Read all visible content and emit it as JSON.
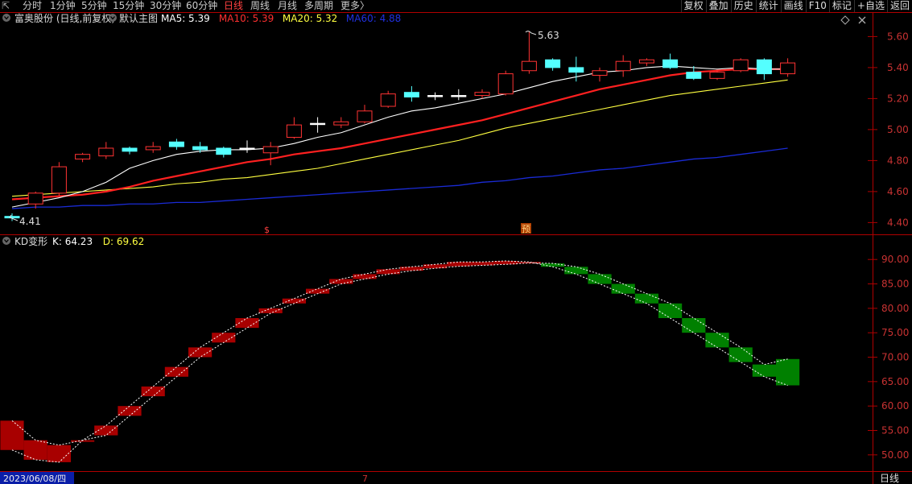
{
  "toolbar": {
    "back_icon": "back-icon",
    "periods": [
      "分时",
      "1分钟",
      "5分钟",
      "15分钟",
      "30分钟",
      "60分钟",
      "日线",
      "周线",
      "月线",
      "多周期",
      "更多〉"
    ],
    "active_period": "日线",
    "right_buttons": [
      "复权",
      "叠加",
      "历史",
      "统计",
      "画线",
      "F10",
      "标记",
      "+自选",
      "返回"
    ]
  },
  "colors": {
    "up": "#ff3333",
    "down": "#54ffff",
    "ma5": "#ffffff",
    "ma10": "#ff2020",
    "ma20": "#ffff40",
    "ma60": "#1a2bd6",
    "kd_up": "#a80000",
    "kd_down": "#008000",
    "axis": "#b00000",
    "axis_text": "#c83232"
  },
  "main_panel": {
    "stock_name": "富奥股份 (日线,前复权)",
    "template": "默认主图",
    "legend": [
      {
        "label": "MA5: 5.39",
        "color": "#ffffff"
      },
      {
        "label": "MA10: 5.39",
        "color": "#ff3030"
      },
      {
        "label": "MA20: 5.32",
        "color": "#ffff40"
      },
      {
        "label": "MA60: 4.88",
        "color": "#2030e0"
      }
    ],
    "high_label": "5.63",
    "low_label": "4.41",
    "markers": [
      "$",
      "预"
    ],
    "diamond_icon": "diamond-icon",
    "close_icon": "close-icon"
  },
  "sub_panel": {
    "indicator": "KD变形",
    "legend": [
      {
        "label": "K: 64.23",
        "color": "#ffffff"
      },
      {
        "label": "D: 69.62",
        "color": "#ffff40"
      }
    ]
  },
  "bottom": {
    "date": "2023/06/08/四",
    "cursor_mark": "7",
    "period_label": "日线"
  },
  "chart_data": [
    {
      "type": "candlestick",
      "ylim": [
        4.35,
        5.68
      ],
      "yticks": [
        4.4,
        4.6,
        4.8,
        5.0,
        5.2,
        5.4,
        5.6
      ],
      "candles": [
        {
          "o": 4.44,
          "h": 4.46,
          "l": 4.41,
          "c": 4.43
        },
        {
          "o": 4.52,
          "h": 4.6,
          "l": 4.49,
          "c": 4.59
        },
        {
          "o": 4.59,
          "h": 4.79,
          "l": 4.57,
          "c": 4.76
        },
        {
          "o": 4.81,
          "h": 4.85,
          "l": 4.79,
          "c": 4.84
        },
        {
          "o": 4.83,
          "h": 4.92,
          "l": 4.81,
          "c": 4.88
        },
        {
          "o": 4.88,
          "h": 4.89,
          "l": 4.84,
          "c": 4.86
        },
        {
          "o": 4.87,
          "h": 4.92,
          "l": 4.85,
          "c": 4.89
        },
        {
          "o": 4.92,
          "h": 4.94,
          "l": 4.87,
          "c": 4.89
        },
        {
          "o": 4.89,
          "h": 4.92,
          "l": 4.85,
          "c": 4.87
        },
        {
          "o": 4.88,
          "h": 4.89,
          "l": 4.82,
          "c": 4.84
        },
        {
          "o": 4.88,
          "h": 4.93,
          "l": 4.85,
          "c": 4.88
        },
        {
          "o": 4.85,
          "h": 4.92,
          "l": 4.77,
          "c": 4.89
        },
        {
          "o": 4.95,
          "h": 5.08,
          "l": 4.94,
          "c": 5.03
        },
        {
          "o": 5.04,
          "h": 5.08,
          "l": 4.98,
          "c": 5.04
        },
        {
          "o": 5.03,
          "h": 5.08,
          "l": 5.01,
          "c": 5.05
        },
        {
          "o": 5.05,
          "h": 5.16,
          "l": 5.04,
          "c": 5.12
        },
        {
          "o": 5.15,
          "h": 5.25,
          "l": 5.14,
          "c": 5.23
        },
        {
          "o": 5.24,
          "h": 5.28,
          "l": 5.18,
          "c": 5.21
        },
        {
          "o": 5.22,
          "h": 5.24,
          "l": 5.19,
          "c": 5.22
        },
        {
          "o": 5.22,
          "h": 5.26,
          "l": 5.19,
          "c": 5.22
        },
        {
          "o": 5.22,
          "h": 5.26,
          "l": 5.2,
          "c": 5.24
        },
        {
          "o": 5.23,
          "h": 5.38,
          "l": 5.22,
          "c": 5.36
        },
        {
          "o": 5.38,
          "h": 5.63,
          "l": 5.36,
          "c": 5.44
        },
        {
          "o": 5.45,
          "h": 5.46,
          "l": 5.38,
          "c": 5.4
        },
        {
          "o": 5.4,
          "h": 5.47,
          "l": 5.31,
          "c": 5.37
        },
        {
          "o": 5.35,
          "h": 5.4,
          "l": 5.31,
          "c": 5.38
        },
        {
          "o": 5.38,
          "h": 5.48,
          "l": 5.34,
          "c": 5.44
        },
        {
          "o": 5.43,
          "h": 5.46,
          "l": 5.41,
          "c": 5.45
        },
        {
          "o": 5.45,
          "h": 5.49,
          "l": 5.39,
          "c": 5.4
        },
        {
          "o": 5.37,
          "h": 5.41,
          "l": 5.32,
          "c": 5.33
        },
        {
          "o": 5.33,
          "h": 5.38,
          "l": 5.32,
          "c": 5.37
        },
        {
          "o": 5.38,
          "h": 5.46,
          "l": 5.37,
          "c": 5.45
        },
        {
          "o": 5.45,
          "h": 5.46,
          "l": 5.32,
          "c": 5.36
        },
        {
          "o": 5.36,
          "h": 5.46,
          "l": 5.34,
          "c": 5.43
        }
      ],
      "ma5": [
        4.5,
        4.53,
        4.56,
        4.6,
        4.66,
        4.75,
        4.8,
        4.84,
        4.86,
        4.87,
        4.87,
        4.88,
        4.91,
        4.95,
        4.98,
        5.03,
        5.08,
        5.12,
        5.14,
        5.17,
        5.2,
        5.23,
        5.27,
        5.31,
        5.34,
        5.37,
        5.38,
        5.4,
        5.41,
        5.4,
        5.39,
        5.4,
        5.39,
        5.39
      ],
      "ma10": [
        4.55,
        4.56,
        4.57,
        4.58,
        4.6,
        4.63,
        4.67,
        4.7,
        4.73,
        4.76,
        4.79,
        4.81,
        4.84,
        4.86,
        4.88,
        4.91,
        4.94,
        4.97,
        5.0,
        5.03,
        5.06,
        5.1,
        5.14,
        5.18,
        5.22,
        5.26,
        5.29,
        5.32,
        5.35,
        5.37,
        5.38,
        5.39,
        5.39,
        5.39
      ],
      "ma20": [
        4.57,
        4.58,
        4.59,
        4.6,
        4.61,
        4.62,
        4.63,
        4.65,
        4.66,
        4.68,
        4.69,
        4.71,
        4.73,
        4.75,
        4.78,
        4.81,
        4.84,
        4.87,
        4.9,
        4.93,
        4.97,
        5.01,
        5.04,
        5.07,
        5.1,
        5.13,
        5.16,
        5.19,
        5.22,
        5.24,
        5.26,
        5.28,
        5.3,
        5.32
      ],
      "ma60": [
        4.49,
        4.5,
        4.5,
        4.51,
        4.51,
        4.52,
        4.52,
        4.53,
        4.53,
        4.54,
        4.55,
        4.56,
        4.57,
        4.58,
        4.59,
        4.6,
        4.61,
        4.62,
        4.63,
        4.64,
        4.66,
        4.67,
        4.69,
        4.7,
        4.72,
        4.74,
        4.75,
        4.77,
        4.79,
        4.81,
        4.82,
        4.84,
        4.86,
        4.88
      ]
    },
    {
      "type": "kd",
      "ylim": [
        47.5,
        93
      ],
      "yticks": [
        50,
        55,
        60,
        65,
        70,
        75,
        80,
        85,
        90
      ],
      "k": [
        57,
        53,
        52,
        53,
        56,
        60,
        64,
        68,
        72,
        75,
        78,
        80,
        82,
        84,
        86,
        87,
        88,
        88.5,
        89,
        89.5,
        89.5,
        89.7,
        89.5,
        88.5,
        87,
        85,
        83,
        81,
        78,
        75,
        72,
        69,
        66,
        64.23
      ],
      "d": [
        51,
        49,
        48.5,
        53,
        54,
        58,
        62,
        66,
        70,
        73,
        76,
        79,
        81,
        83,
        85,
        86,
        87,
        87.7,
        88.2,
        88.6,
        88.8,
        89,
        89.3,
        89.2,
        88.5,
        87,
        85,
        83,
        81,
        78,
        75,
        72,
        68.5,
        69.62
      ]
    }
  ]
}
